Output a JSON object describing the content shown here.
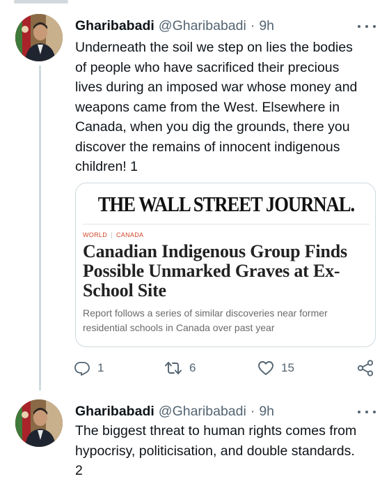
{
  "tweets": [
    {
      "author": {
        "name": "Gharibabadi",
        "handle": "@Gharibabadi",
        "separator": "·",
        "time": "9h"
      },
      "text": "Underneath the soil we step on lies the bodies\nof people who have sacrificed their precious\nlives during an imposed war whose money and\nweapons came from the West. Elsewhere in\nCanada, when you dig the grounds, there you\ndiscover the remains of innocent indigenous\nchildren! 1",
      "card": {
        "masthead": "THE WALL STREET JOURNAL.",
        "tags": [
          "WORLD",
          "CANADA"
        ],
        "headline": "Canadian Indigenous Group Finds\nPossible Unmarked Graves at Ex-\nSchool Site",
        "summary": "Report follows a series of similar discoveries near former\nresidential schools in Canada over past year"
      },
      "actions": {
        "reply_icon": "reply-icon",
        "replies": "1",
        "retweet_icon": "retweet-icon",
        "retweets": "6",
        "like_icon": "heart-icon",
        "likes": "15",
        "share_icon": "share-icon"
      }
    },
    {
      "author": {
        "name": "Gharibabadi",
        "handle": "@Gharibabadi",
        "separator": "·",
        "time": "9h"
      },
      "text": "The biggest threat to human rights comes from\nhypocrisy, politicisation, and double standards.\n2"
    }
  ],
  "colors": {
    "text": "#0f1419",
    "secondary": "#536471",
    "border": "#cfd9de",
    "tag_accent": "#d0472a"
  }
}
